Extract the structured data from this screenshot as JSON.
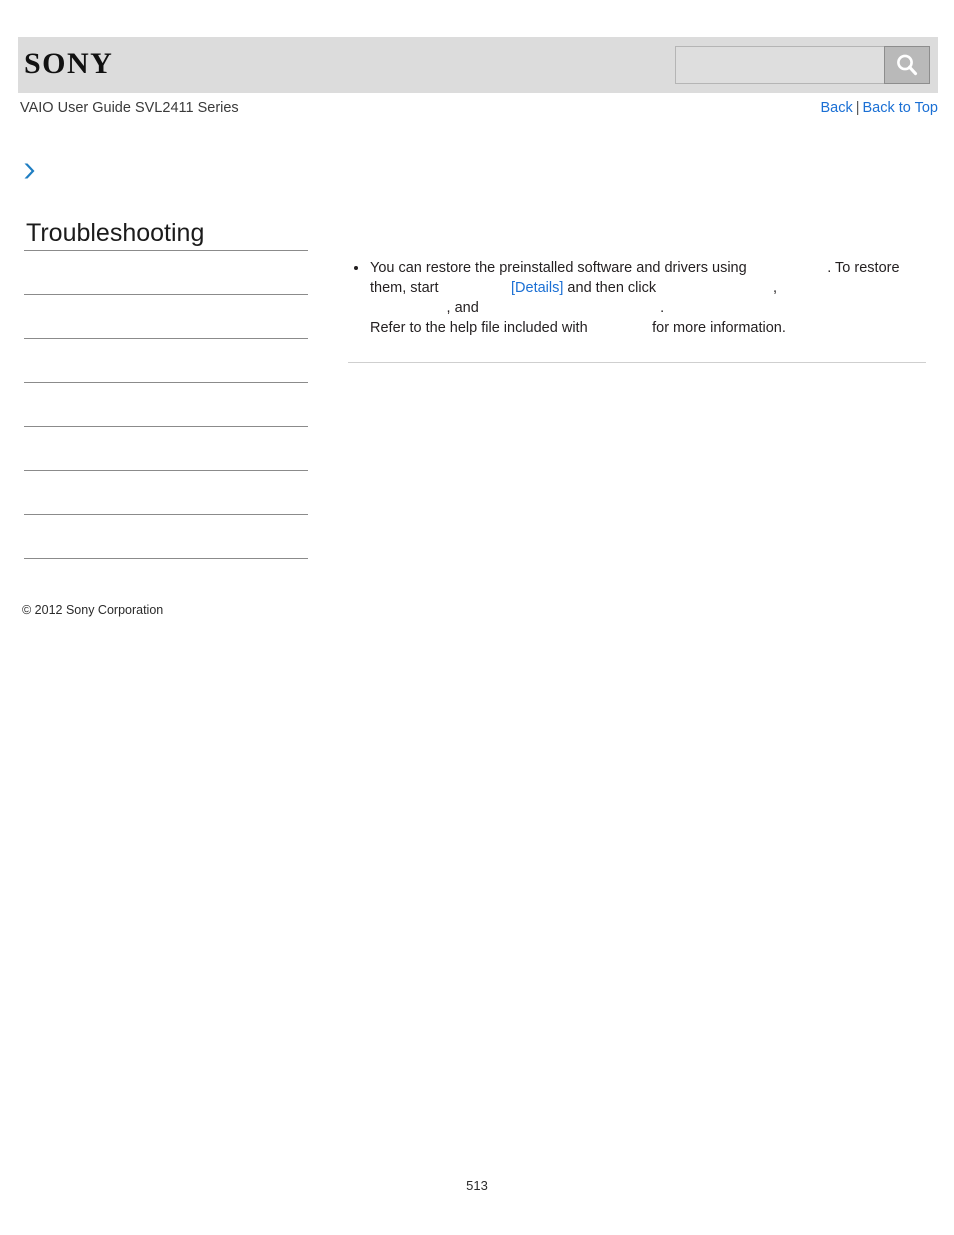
{
  "header": {
    "logo_text": "SONY",
    "search": {
      "value": "",
      "placeholder": "",
      "button_icon": "search-icon"
    }
  },
  "subheader": {
    "guide_title": "VAIO User Guide SVL2411 Series",
    "back_label": "Back",
    "separator": "|",
    "back_to_top_label": "Back to Top"
  },
  "breadcrumb": {
    "icon": "chevron-right-icon",
    "text": ""
  },
  "sidebar": {
    "title": "Troubleshooting",
    "items": [
      {
        "label": ""
      },
      {
        "label": ""
      },
      {
        "label": ""
      },
      {
        "label": ""
      },
      {
        "label": ""
      },
      {
        "label": ""
      },
      {
        "label": ""
      }
    ],
    "copyright": "© 2012 Sony Corporation"
  },
  "content": {
    "bullets": [
      {
        "line1_a": "You can restore the preinstalled software and drivers using",
        "line1_gap": "                    ",
        "line1_b": ". To restore",
        "line2_a": "them, start",
        "line2_gap1": "                  ",
        "line2_link": "[Details]",
        "line2_b": " and then click",
        "line2_gap2": "                             ",
        "line2_c": ",",
        "line3_gap1": "                   ",
        "line3_a": ", and",
        "line3_gap2": "                                             ",
        "line3_b": ".",
        "line4_a": "Refer to the help file included with",
        "line4_gap": "                ",
        "line4_b": "for more information."
      }
    ]
  },
  "footer": {
    "page_number": "513"
  },
  "colors": {
    "link": "#1a6fd4",
    "header_band": "#dcdcdc",
    "rule": "#8b8b8b",
    "content_rule": "#cfcfcf",
    "chevron": "#1f7ec2"
  }
}
